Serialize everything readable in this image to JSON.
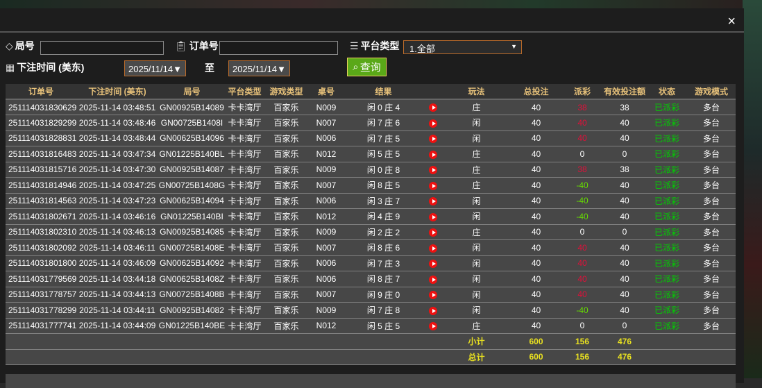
{
  "filters": {
    "round_label": "局号",
    "round_value": "",
    "order_label": "订单号",
    "order_value": "",
    "platform_label": "平台类型",
    "platform_value": "1.全部",
    "time_label": "下注时间 (美东)",
    "date_from": "2025/11/14",
    "to_label": "至",
    "date_to": "2025/11/14",
    "search_label": "查询"
  },
  "close_label": "×",
  "table": {
    "headers": [
      "订单号",
      "下注时间 (美东)",
      "局号",
      "平台类型",
      "游戏类型",
      "桌号",
      "结果",
      "",
      "玩法",
      "总投注",
      "派彩",
      "有效投注额",
      "状态",
      "游戏模式"
    ],
    "rows": [
      [
        "251114031830629",
        "2025-11-14 03:48:51",
        "GN00925B14089",
        "卡卡湾厅",
        "百家乐",
        "N009",
        "闲 0 庄 4",
        "庄",
        "40",
        "38",
        "38",
        "已派彩",
        "多台"
      ],
      [
        "251114031829299",
        "2025-11-14 03:48:46",
        "GN00725B1408I",
        "卡卡湾厅",
        "百家乐",
        "N007",
        "闲 7 庄 6",
        "闲",
        "40",
        "40",
        "40",
        "已派彩",
        "多台"
      ],
      [
        "251114031828831",
        "2025-11-14 03:48:44",
        "GN00625B14096",
        "卡卡湾厅",
        "百家乐",
        "N006",
        "闲 7 庄 5",
        "闲",
        "40",
        "40",
        "40",
        "已派彩",
        "多台"
      ],
      [
        "251114031816483",
        "2025-11-14 03:47:34",
        "GN01225B140BL",
        "卡卡湾厅",
        "百家乐",
        "N012",
        "闲 5 庄 5",
        "庄",
        "40",
        "0",
        "0",
        "已派彩",
        "多台"
      ],
      [
        "251114031815716",
        "2025-11-14 03:47:30",
        "GN00925B14087",
        "卡卡湾厅",
        "百家乐",
        "N009",
        "闲 0 庄 8",
        "庄",
        "40",
        "38",
        "38",
        "已派彩",
        "多台"
      ],
      [
        "251114031814946",
        "2025-11-14 03:47:25",
        "GN00725B1408G",
        "卡卡湾厅",
        "百家乐",
        "N007",
        "闲 8 庄 5",
        "庄",
        "40",
        "-40",
        "40",
        "已派彩",
        "多台"
      ],
      [
        "251114031814563",
        "2025-11-14 03:47:23",
        "GN00625B14094",
        "卡卡湾厅",
        "百家乐",
        "N006",
        "闲 3 庄 7",
        "闲",
        "40",
        "-40",
        "40",
        "已派彩",
        "多台"
      ],
      [
        "251114031802671",
        "2025-11-14 03:46:16",
        "GN01225B140BI",
        "卡卡湾厅",
        "百家乐",
        "N012",
        "闲 4 庄 9",
        "闲",
        "40",
        "-40",
        "40",
        "已派彩",
        "多台"
      ],
      [
        "251114031802310",
        "2025-11-14 03:46:13",
        "GN00925B14085",
        "卡卡湾厅",
        "百家乐",
        "N009",
        "闲 2 庄 2",
        "庄",
        "40",
        "0",
        "0",
        "已派彩",
        "多台"
      ],
      [
        "251114031802092",
        "2025-11-14 03:46:11",
        "GN00725B1408E",
        "卡卡湾厅",
        "百家乐",
        "N007",
        "闲 8 庄 6",
        "闲",
        "40",
        "40",
        "40",
        "已派彩",
        "多台"
      ],
      [
        "251114031801800",
        "2025-11-14 03:46:09",
        "GN00625B14092",
        "卡卡湾厅",
        "百家乐",
        "N006",
        "闲 7 庄 3",
        "闲",
        "40",
        "40",
        "40",
        "已派彩",
        "多台"
      ],
      [
        "251114031779569",
        "2025-11-14 03:44:18",
        "GN00625B1408Z",
        "卡卡湾厅",
        "百家乐",
        "N006",
        "闲 8 庄 7",
        "闲",
        "40",
        "40",
        "40",
        "已派彩",
        "多台"
      ],
      [
        "251114031778757",
        "2025-11-14 03:44:13",
        "GN00725B1408B",
        "卡卡湾厅",
        "百家乐",
        "N007",
        "闲 9 庄 0",
        "闲",
        "40",
        "40",
        "40",
        "已派彩",
        "多台"
      ],
      [
        "251114031778299",
        "2025-11-14 03:44:11",
        "GN00925B14082",
        "卡卡湾厅",
        "百家乐",
        "N009",
        "闲 7 庄 8",
        "闲",
        "40",
        "-40",
        "40",
        "已派彩",
        "多台"
      ],
      [
        "251114031777741",
        "2025-11-14 03:44:09",
        "GN01225B140BE",
        "卡卡湾厅",
        "百家乐",
        "N012",
        "闲 5 庄 5",
        "庄",
        "40",
        "0",
        "0",
        "已派彩",
        "多台"
      ]
    ],
    "subtotal": {
      "label": "小计",
      "total_bet": "600",
      "payout": "156",
      "valid_bet": "476"
    },
    "total": {
      "label": "总计",
      "total_bet": "600",
      "payout": "156",
      "valid_bet": "476"
    }
  },
  "colors": {
    "payout_positive": "#e0103a",
    "payout_negative": "#66dd00",
    "status": "#00d000",
    "header_text": "#e8c27a",
    "totals": "#e8e020",
    "search_button": "#5aa818"
  }
}
